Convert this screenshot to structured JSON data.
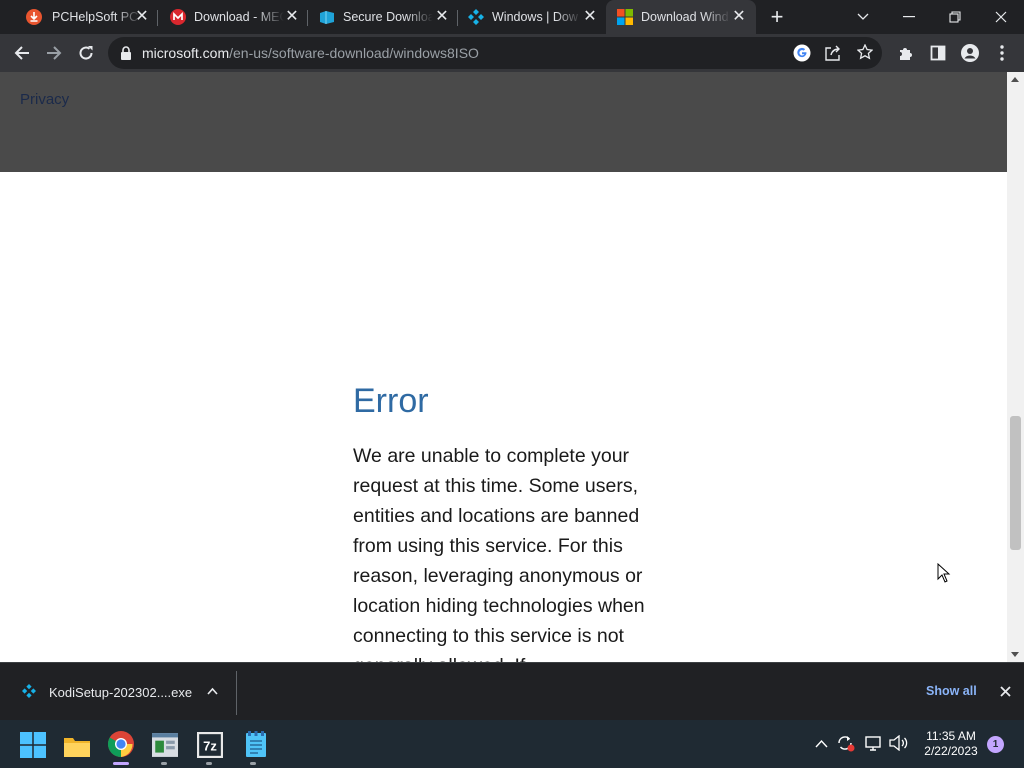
{
  "tabs": [
    {
      "title": "PCHelpSoft PC C",
      "favicon": "download-circle-icon",
      "active": false
    },
    {
      "title": "Download - MEG",
      "favicon": "mega-icon",
      "active": false
    },
    {
      "title": "Secure Downloa",
      "favicon": "blue-box-icon",
      "active": false
    },
    {
      "title": "Windows | Dow",
      "favicon": "kodi-icon",
      "active": false
    },
    {
      "title": "Download Wind",
      "favicon": "microsoft-logo-icon",
      "active": true
    }
  ],
  "address_bar": {
    "host": "microsoft.com",
    "path": "/en-us/software-download/windows8ISO"
  },
  "page": {
    "footer_link": "Privacy",
    "error_title": "Error",
    "error_body": "We are unable to complete your request at this time. Some users, entities and locations are banned from using this service. For this reason, leveraging anonymous or location hiding technologies when connecting to this service is not generally allowed. If"
  },
  "download_bar": {
    "filename": "KodiSetup-202302....exe",
    "show_all": "Show all"
  },
  "taskbar": {
    "time": "11:35 AM",
    "date": "2/22/2023",
    "notification_count": "1"
  },
  "colors": {
    "accent_blue": "#2f6aa3",
    "chrome_dark": "#202124",
    "toolbar": "#35363a",
    "link_blue": "#8ab4f8"
  }
}
